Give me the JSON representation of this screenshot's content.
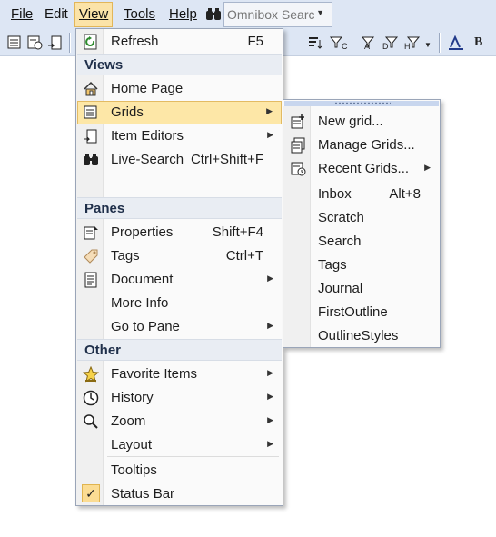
{
  "menubar": {
    "items": [
      "File",
      "Edit",
      "View",
      "Tools",
      "Help"
    ],
    "omnibox_placeholder": "Omnibox Search"
  },
  "toolbar": {
    "glyphs": [
      "C",
      "A",
      "D",
      "H",
      "B"
    ]
  },
  "view_menu": {
    "refresh": {
      "label": "Refresh",
      "shortcut": "F5"
    },
    "sections": {
      "views": "Views",
      "panes": "Panes",
      "other": "Other"
    },
    "views_items": [
      {
        "label": "Home Page",
        "icon": "home-icon"
      },
      {
        "label": "Grids",
        "icon": "grid-icon",
        "submenu": true,
        "highlighted": true
      },
      {
        "label": "Item Editors",
        "icon": "item-editor-icon",
        "submenu": true
      },
      {
        "label": "Live-Search",
        "shortcut": "Ctrl+Shift+F",
        "icon": "binoculars-icon"
      }
    ],
    "panes_items": [
      {
        "label": "Properties",
        "shortcut": "Shift+F4",
        "icon": "properties-icon"
      },
      {
        "label": "Tags",
        "shortcut": "Ctrl+T",
        "icon": "tag-icon"
      },
      {
        "label": "Document",
        "icon": "document-icon",
        "submenu": true
      },
      {
        "label": "More Info"
      },
      {
        "label": "Go to Pane",
        "submenu": true
      }
    ],
    "other_items": [
      {
        "label": "Favorite Items",
        "icon": "star-icon",
        "submenu": true
      },
      {
        "label": "History",
        "icon": "clock-icon",
        "submenu": true
      },
      {
        "label": "Zoom",
        "icon": "magnifier-icon",
        "submenu": true
      },
      {
        "label": "Layout",
        "submenu": true
      },
      {
        "label": "Tooltips"
      },
      {
        "label": "Status Bar",
        "checked": true,
        "check_glyph": "✓"
      }
    ]
  },
  "grids_submenu": {
    "actions": [
      {
        "label": "New grid...",
        "icon": "new-grid-icon"
      },
      {
        "label": "Manage Grids...",
        "icon": "manage-grids-icon"
      },
      {
        "label": "Recent Grids...",
        "icon": "recent-grids-icon",
        "submenu": true
      }
    ],
    "grids": [
      {
        "label": "Inbox",
        "shortcut": "Alt+8"
      },
      {
        "label": "Scratch"
      },
      {
        "label": "Search"
      },
      {
        "label": "Tags"
      },
      {
        "label": "Journal"
      },
      {
        "label": "FirstOutline"
      },
      {
        "label": "OutlineStyles"
      }
    ]
  },
  "colors": {
    "highlight": "#fde7a7",
    "highlight_border": "#e3bb63",
    "menubar_bg": "#dde6f4",
    "section_bg": "#e9edf3"
  }
}
